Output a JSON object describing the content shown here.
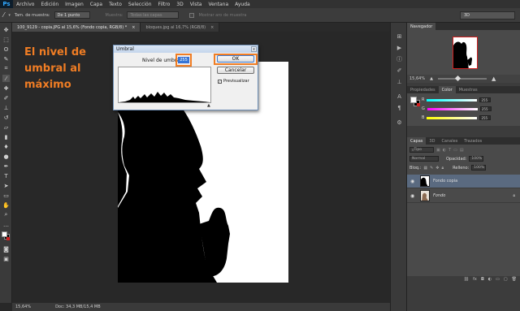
{
  "app": {
    "logo": "Ps"
  },
  "menu": [
    "Archivo",
    "Edición",
    "Imagen",
    "Capa",
    "Texto",
    "Selección",
    "Filtro",
    "3D",
    "Vista",
    "Ventana",
    "Ayuda"
  ],
  "options": {
    "sample_size_label": "Tam. de muestra:",
    "sample_size_value": "De 1 punto",
    "sample_label": "Muestra:",
    "sample_value": "Todas las capas",
    "show_ring_label": "Mostrar aro de muestra",
    "workspace": "3D"
  },
  "tabs": [
    {
      "label": "100_9129 - copia.JPG al 15,6% (Fondo copia, RGB/8) *",
      "close": "×"
    },
    {
      "label": "bloques.jpg al 16,7% (RGB/8)",
      "close": "×"
    }
  ],
  "annotation": {
    "line1": "El nivel de",
    "line2": "umbral al",
    "line3": "máximo"
  },
  "dialog": {
    "title": "Umbral",
    "close_glyph": "x",
    "level_label": "Nivel de umbral:",
    "level_value": "255",
    "ok_label": "OK",
    "cancel_label": "Cancelar",
    "preview_label": "Previsualizar",
    "preview_checked": true,
    "check_glyph": "✓"
  },
  "status": {
    "zoom": "15,64%",
    "doc": "Doc: 34,3 MB/15,4 MB"
  },
  "panels": {
    "navigator_tab": "Navegador",
    "nav_zoom": "15,64%",
    "properties_tab": "Propiedades",
    "color_tab": "Color",
    "swatches_tab": "Muestras",
    "color": {
      "r_label": "R",
      "r": "255",
      "g_label": "G",
      "g": "255",
      "b_label": "B",
      "b": "255"
    },
    "layers_tabs": [
      "Capas",
      "3D",
      "Canales",
      "Trazados"
    ],
    "kind": "Tipo",
    "blend_mode": "Normal",
    "opacity_label": "Opacidad:",
    "opacity": "100%",
    "lock_label": "Bloq.:",
    "fill_label": "Relleno:",
    "fill": "100%",
    "layers": [
      {
        "name": "Fondo copia",
        "selected": true
      },
      {
        "name": "Fondo",
        "selected": false
      }
    ]
  },
  "colors": {
    "accent": "#f07d24",
    "selection": "#5a6a80",
    "brand": "#31a8ff"
  }
}
